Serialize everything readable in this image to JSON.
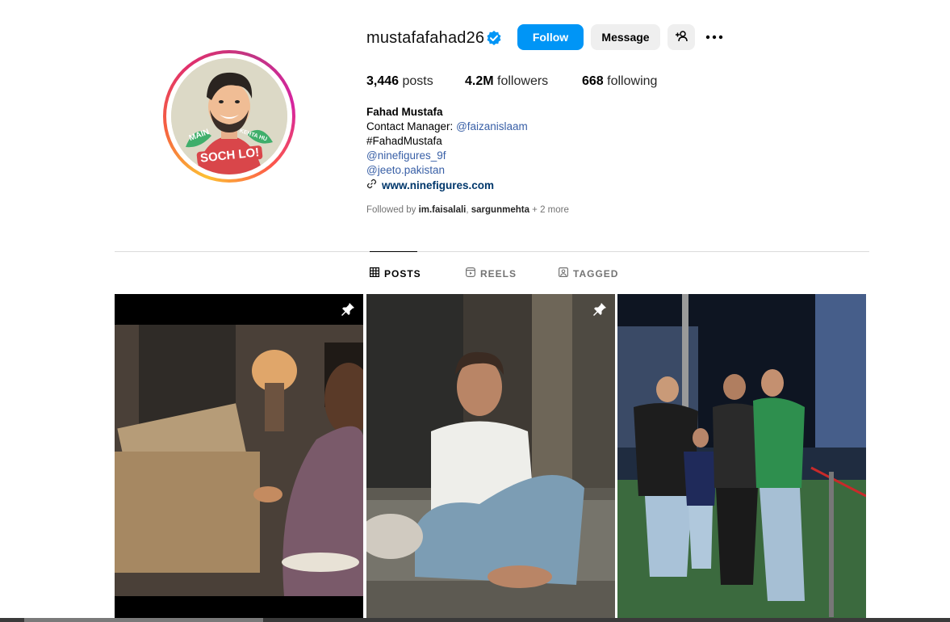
{
  "profile": {
    "username": "mustafafahad26",
    "verified": true,
    "follow_label": "Follow",
    "message_label": "Message",
    "avatar_text_left": "MAIN",
    "avatar_text_right": "KEHTA HU",
    "avatar_text_bottom": "SOCH LO!"
  },
  "stats": {
    "posts_count": "3,446",
    "posts_label": "posts",
    "followers_count": "4.2M",
    "followers_label": "followers",
    "following_count": "668",
    "following_label": "following"
  },
  "bio": {
    "name": "Fahad Mustafa",
    "contact_prefix": "Contact Manager: ",
    "contact_handle": "@faizanislaam",
    "hashtag": "#FahadMustafa",
    "link1": "@ninefigures_9f",
    "link2": "@jeeto.pakistan",
    "website": "www.ninefigures.com"
  },
  "followed_by": {
    "prefix": "Followed by ",
    "user1": "im.faisalali",
    "separator": ", ",
    "user2": "sargunmehta",
    "more": " + 2 more"
  },
  "tabs": [
    {
      "label": "POSTS",
      "icon": "grid-icon",
      "active": true
    },
    {
      "label": "REELS",
      "icon": "reels-icon",
      "active": false
    },
    {
      "label": "TAGGED",
      "icon": "tagged-icon",
      "active": false
    }
  ],
  "posts": [
    {
      "pinned": true,
      "scene": "man-with-cardboard-box"
    },
    {
      "pinned": true,
      "scene": "man-seated-on-sofa"
    },
    {
      "pinned": false,
      "scene": "group-at-cricket-stadium"
    }
  ],
  "colors": {
    "follow_button": "#0095f6",
    "link": "#385fa6",
    "verified_badge": "#0095f6"
  }
}
